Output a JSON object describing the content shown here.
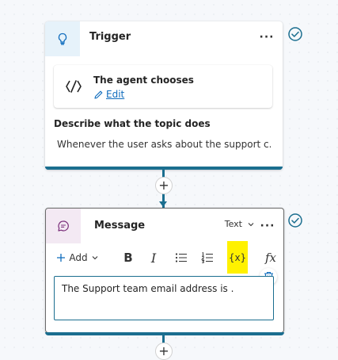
{
  "trigger_card": {
    "title": "Trigger",
    "more_label": "···",
    "agent": {
      "title": "The agent chooses",
      "edit_label": "Edit"
    },
    "description_label": "Describe what the topic does",
    "description_value": "Whenever the user asks about the support c..."
  },
  "message_card": {
    "title": "Message",
    "type_dropdown": "Text",
    "more_label": "···",
    "toolbar": {
      "add_label": "Add",
      "bold_label": "B",
      "italic_label": "I",
      "variable_label": "{x}",
      "formula_label": "fx"
    },
    "message_text": "The Support team email address is ."
  },
  "connector": {
    "add_label": "+"
  },
  "colors": {
    "accent": "#0f6cbd",
    "flow_line": "#1b6e8f",
    "highlight": "#fff100",
    "check": "#1b6e8f"
  }
}
